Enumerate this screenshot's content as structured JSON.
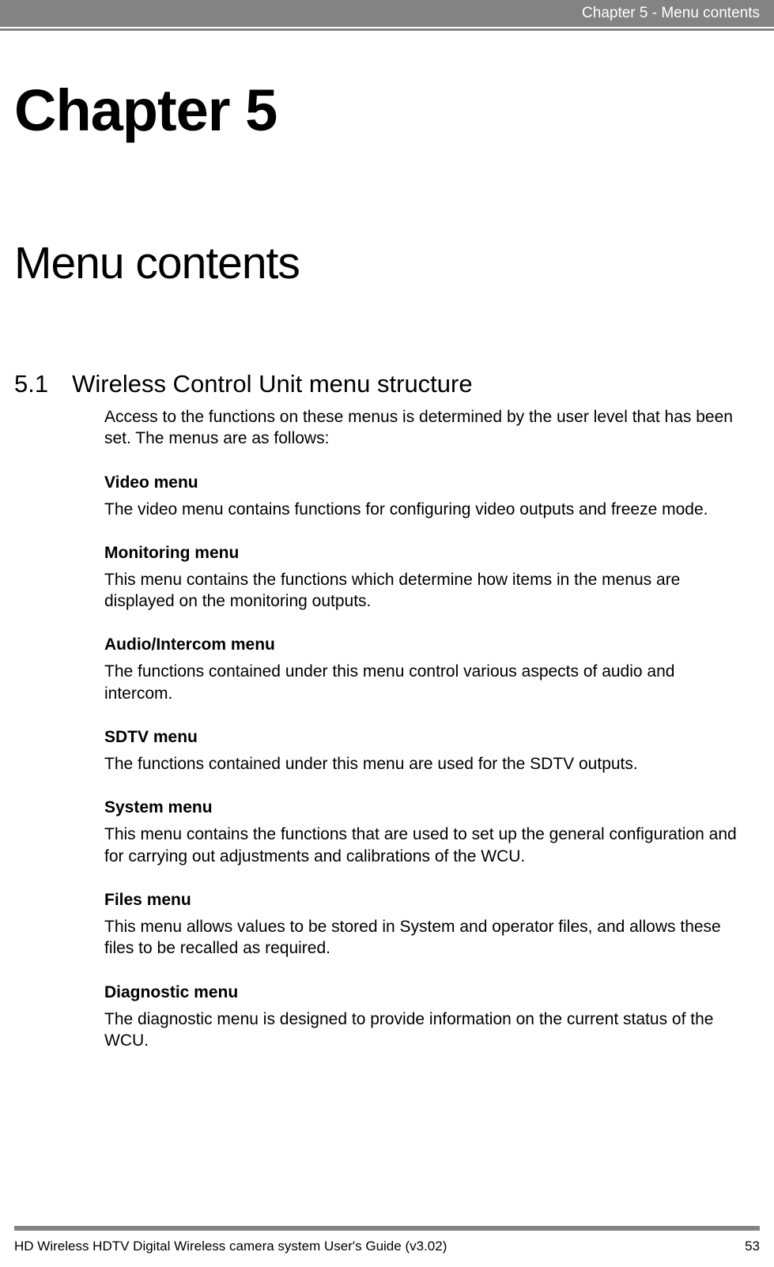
{
  "header": {
    "running_title": "Chapter 5 - Menu contents"
  },
  "chapter": {
    "title": "Chapter 5",
    "subtitle": "Menu contents"
  },
  "section": {
    "number": "5.1",
    "title": "Wireless Control Unit menu structure",
    "intro": "Access to the functions on these menus is determined by the user level that has been set. The menus are as follows:"
  },
  "menus": [
    {
      "heading": "Video menu",
      "desc": "The video menu contains functions for configuring video outputs and freeze mode."
    },
    {
      "heading": "Monitoring menu",
      "desc": "This menu contains the functions which determine how items in the menus are displayed on the monitoring outputs."
    },
    {
      "heading": "Audio/Intercom menu",
      "desc": "The functions contained under this menu control various aspects of audio and intercom."
    },
    {
      "heading": "SDTV menu",
      "desc": "The functions contained under this menu are used for the SDTV outputs."
    },
    {
      "heading": "System menu",
      "desc": "This menu contains the functions that are used to set up the general configuration and for carrying out adjustments and calibrations of the WCU."
    },
    {
      "heading": "Files menu",
      "desc": "This menu allows values to be stored in System and operator files, and allows these files to be recalled as required."
    },
    {
      "heading": "Diagnostic menu",
      "desc": "The diagnostic menu is designed to provide information on the current status of the WCU."
    }
  ],
  "footer": {
    "doc_title": "HD Wireless HDTV Digital Wireless camera system User's Guide (v3.02)",
    "page": "53"
  }
}
